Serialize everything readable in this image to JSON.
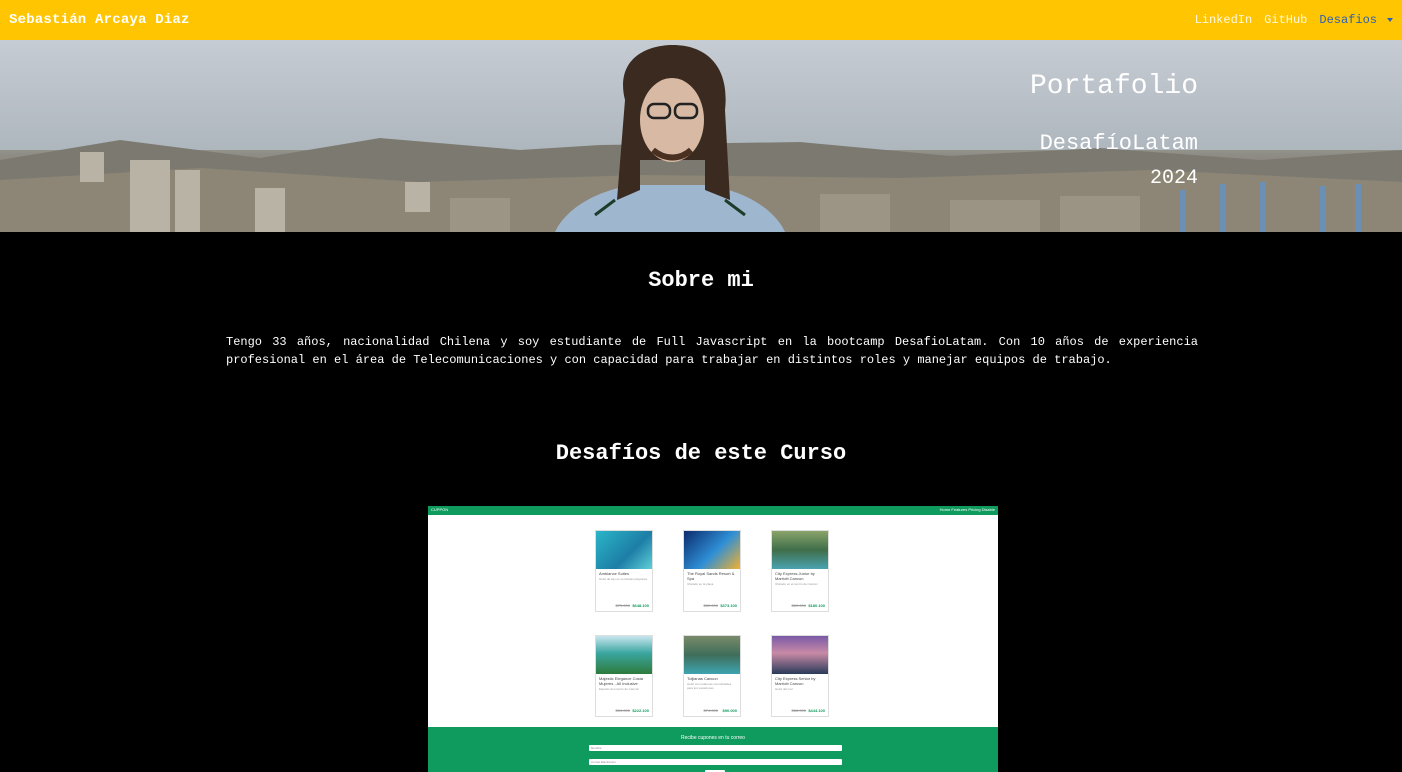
{
  "navbar": {
    "brand": "Sebastián Arcaya Diaz",
    "links": [
      "LinkedIn",
      "GitHub"
    ],
    "dropdown_label": "Desafios",
    "bg_color": "#ffc500"
  },
  "hero": {
    "title": "Portafolio",
    "subtitle": "DesafíoLatam",
    "year": "2024"
  },
  "about": {
    "heading": "Sobre mi",
    "text": "Tengo 33 años, nacionalidad Chilena y soy estudiante de Full Javascript en la bootcamp DesafioLatam. Con 10 años de experiencia profesional en el área de Telecomunicaciones y con capacidad para trabajar en distintos roles y manejar equipos de trabajo."
  },
  "challenges": {
    "heading": "Desafíos de este Curso"
  },
  "preview": {
    "nav_logo": "CUPPON",
    "nav_links": "Home  Features  Pricing  Disable",
    "cards": [
      {
        "title": "Ambiance Suites",
        "desc": "Hotel de lujo en cercanías playas/as",
        "old": "$75.000",
        "price": "$648.100"
      },
      {
        "title": "The Royal Sands Resort & Spa",
        "desc": "Ubicado en la playa",
        "old": "$62.000",
        "price": "$373.100"
      },
      {
        "title": "City Express Junior by Marriott Cancun",
        "desc": "Ubicado en el centro de Cancún",
        "old": "$80.000",
        "price": "$180.100"
      },
      {
        "title": "Majestic Elegance Costa Mujeres - All Inclusive",
        "desc": "Espacio del centro de Cancún",
        "old": "$61.000",
        "price": "$222.100"
      },
      {
        "title": "Tuljianas Cancun",
        "desc": "Hotel con todas las comodidades para tus vacaciones",
        "old": "$74.000",
        "price": "$90.000"
      },
      {
        "title": "City Express Senior by Marriott Cancun",
        "desc": "Hotel del mar",
        "old": "$88.000",
        "price": "$444.100"
      }
    ],
    "footer_title": "Recibe cupones en tu correo",
    "input1_placeholder": "Nombre",
    "input2_placeholder": "Correo Electrónico"
  }
}
